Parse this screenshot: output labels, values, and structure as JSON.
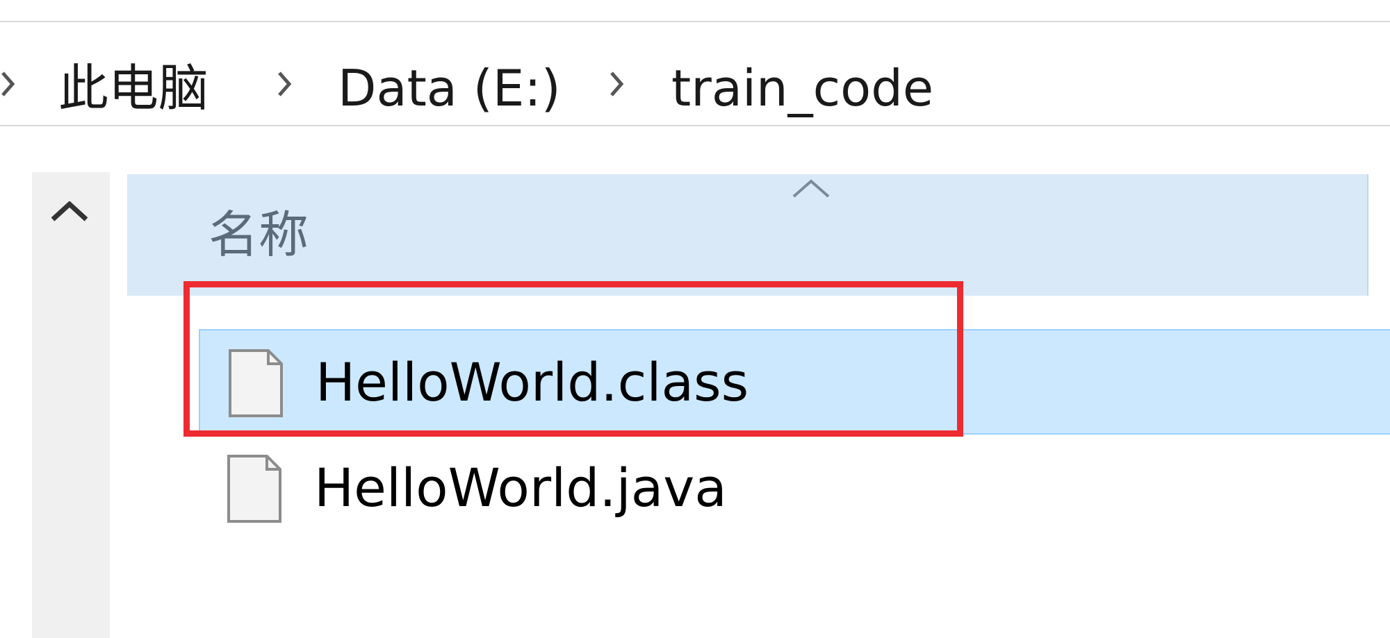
{
  "address_bar": {
    "crumbs": [
      "此电脑",
      "Data (E:)",
      "train_code"
    ]
  },
  "header": {
    "name_column_label": "名称",
    "sort_icon": "chevron-up-icon"
  },
  "files": [
    {
      "name": "HelloWorld.class",
      "icon": "file-icon",
      "selected": true
    },
    {
      "name": "HelloWorld.java",
      "icon": "file-icon",
      "selected": false
    }
  ],
  "colors": {
    "selection_bg": "#cce8ff",
    "header_bg": "#d9e9f7",
    "highlight_border": "#ee2b31"
  }
}
